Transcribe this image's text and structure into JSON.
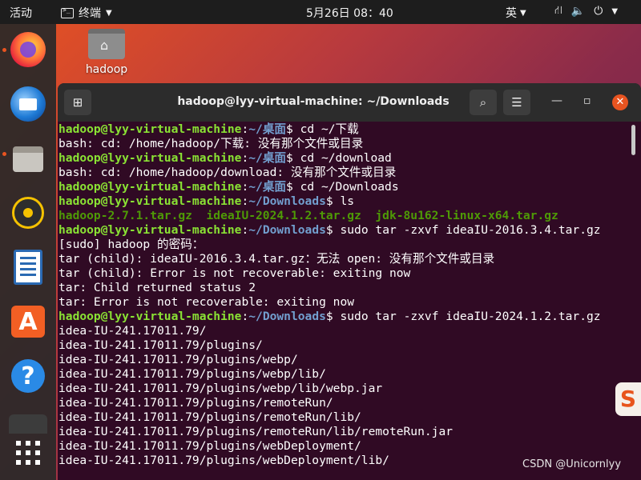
{
  "topbar": {
    "activities": "活动",
    "app_name": "终端",
    "clock": "5月26日  08：40",
    "ime": "英",
    "tray_icons": [
      "network-icon",
      "volume-icon",
      "power-icon"
    ]
  },
  "dock": {
    "items": [
      "firefox",
      "thunderbird",
      "files",
      "rhythmbox",
      "libreoffice-writer",
      "app-store",
      "help",
      "terminal",
      "show-apps"
    ]
  },
  "desktop": {
    "home_folder_label": "hadoop"
  },
  "terminal": {
    "title": "hadoop@lyy-virtual-machine: ~/Downloads",
    "user_host": "hadoop@lyy-virtual-machine",
    "lines": [
      {
        "type": "prompt",
        "path": "~/桌面",
        "cmd": " cd ~/下载"
      },
      {
        "type": "out",
        "text": "bash: cd: /home/hadoop/下载: 没有那个文件或目录"
      },
      {
        "type": "prompt",
        "path": "~/桌面",
        "cmd": " cd ~/download"
      },
      {
        "type": "out",
        "text": "bash: cd: /home/hadoop/download: 没有那个文件或目录"
      },
      {
        "type": "prompt",
        "path": "~/桌面",
        "cmd": " cd ~/Downloads"
      },
      {
        "type": "prompt",
        "path": "~/Downloads",
        "cmd": " ls"
      },
      {
        "type": "files",
        "text": "hadoop-2.7.1.tar.gz  ideaIU-2024.1.2.tar.gz  jdk-8u162-linux-x64.tar.gz"
      },
      {
        "type": "prompt",
        "path": "~/Downloads",
        "cmd": " sudo tar -zxvf ideaIU-2016.3.4.tar.gz"
      },
      {
        "type": "out",
        "text": "[sudo] hadoop 的密码："
      },
      {
        "type": "out",
        "text": "tar (child): ideaIU-2016.3.4.tar.gz：无法 open: 没有那个文件或目录"
      },
      {
        "type": "out",
        "text": "tar (child): Error is not recoverable: exiting now"
      },
      {
        "type": "out",
        "text": "tar: Child returned status 2"
      },
      {
        "type": "out",
        "text": "tar: Error is not recoverable: exiting now"
      },
      {
        "type": "prompt",
        "path": "~/Downloads",
        "cmd": " sudo tar -zxvf ideaIU-2024.1.2.tar.gz"
      },
      {
        "type": "out",
        "text": "idea-IU-241.17011.79/"
      },
      {
        "type": "out",
        "text": "idea-IU-241.17011.79/plugins/"
      },
      {
        "type": "out",
        "text": "idea-IU-241.17011.79/plugins/webp/"
      },
      {
        "type": "out",
        "text": "idea-IU-241.17011.79/plugins/webp/lib/"
      },
      {
        "type": "out",
        "text": "idea-IU-241.17011.79/plugins/webp/lib/webp.jar"
      },
      {
        "type": "out",
        "text": "idea-IU-241.17011.79/plugins/remoteRun/"
      },
      {
        "type": "out",
        "text": "idea-IU-241.17011.79/plugins/remoteRun/lib/"
      },
      {
        "type": "out",
        "text": "idea-IU-241.17011.79/plugins/remoteRun/lib/remoteRun.jar"
      },
      {
        "type": "out",
        "text": "idea-IU-241.17011.79/plugins/webDeployment/"
      },
      {
        "type": "out",
        "text": "idea-IU-241.17011.79/plugins/webDeployment/lib/"
      }
    ]
  },
  "watermark": "CSDN @Unicornlyy",
  "sogou_glyph": "S"
}
